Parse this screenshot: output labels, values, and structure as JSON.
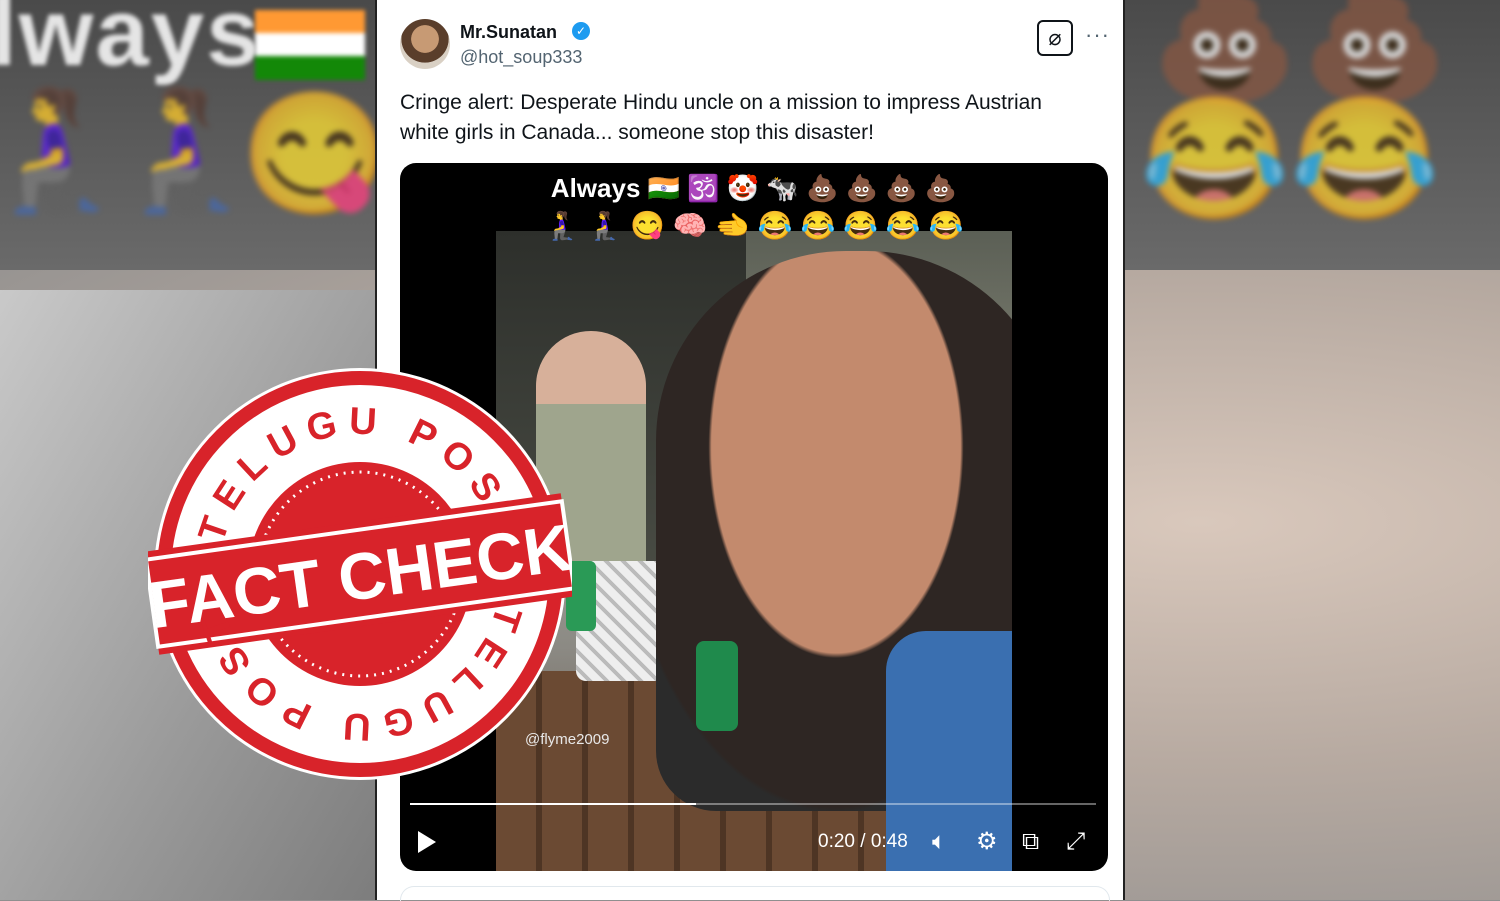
{
  "background": {
    "text": "lways",
    "emojis": [
      "🧎‍♀️",
      "🧎‍♀️",
      "😋",
      "💩",
      "💩",
      "😂",
      "😂"
    ]
  },
  "tweet": {
    "author_name": "Mr.Sunatan",
    "handle": "@hot_soup333",
    "verified": true,
    "text": "Cringe alert: Desperate Hindu uncle on a mission to impress Austrian white girls in Canada... someone stop this disaster!",
    "grok_icon": "slash-circle-icon",
    "more_label": "···"
  },
  "video": {
    "overlay_line1": "Always 🇮🇳 🕉️ 🤡 🐄 💩 💩 💩 💩",
    "overlay_line2": "🧎‍♀️ 🧎‍♀️ 😋 🧠 🫲 😂 😂 😂 😂 😂",
    "watermark": "@flyme2009",
    "elapsed": "0:20",
    "duration": "0:48",
    "time_display": "0:20 / 0:48",
    "progress_fraction": 0.4167,
    "controls": {
      "play": "play-icon",
      "volume": "volume-icon",
      "settings": "gear-icon",
      "pip": "pip-icon",
      "fullscreen": "fullscreen-icon"
    }
  },
  "stamp": {
    "top_arc": "TELUGU POST",
    "banner": "FACT CHECK",
    "bottom_arc": "TELUGU POST",
    "color": "#d8232a"
  }
}
